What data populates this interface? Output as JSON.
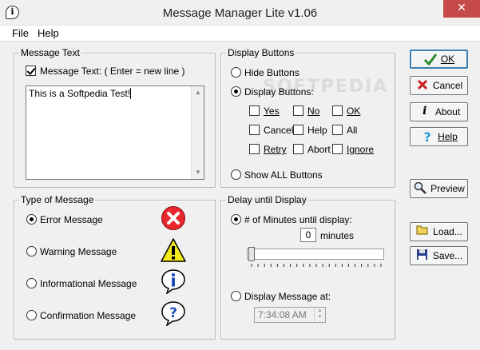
{
  "window": {
    "title": "Message Manager Lite v1.06",
    "close": "✕"
  },
  "menu": {
    "file": "File",
    "help": "Help"
  },
  "watermark": "SOFTPEDIA",
  "message_text": {
    "legend": "Message Text",
    "checkbox_label": "Message Text: ( Enter = new line )",
    "checkbox_checked": true,
    "value": "This is a Softpedia Test!"
  },
  "display_buttons": {
    "legend": "Display Buttons",
    "hide": "Hide Buttons",
    "display": "Display Buttons:",
    "selected": "display",
    "options": {
      "yes": "Yes",
      "no": "No",
      "ok": "OK",
      "cancel": "Cancel",
      "help": "Help",
      "all": "All",
      "retry": "Retry",
      "abort": "Abort",
      "ignore": "Ignore"
    },
    "show_all": "Show ALL Buttons"
  },
  "type_of_message": {
    "legend": "Type of Message",
    "error": "Error Message",
    "warning": "Warning Message",
    "info": "Informational Message",
    "confirm": "Confirmation Message",
    "selected": "error"
  },
  "delay": {
    "legend": "Delay until Display",
    "minutes_label": "# of Minutes until display:",
    "minutes_value": "0",
    "minutes_unit": "minutes",
    "display_at_label": "Display Message at:",
    "time_value": "7:34:08 AM",
    "selected": "minutes",
    "slider_level": 0
  },
  "buttons": {
    "ok": "OK",
    "cancel": "Cancel",
    "about": "About",
    "help": "Help",
    "preview": "Preview",
    "load": "Load...",
    "save": "Save..."
  },
  "colors": {
    "error": "#e8262c",
    "warning": "#f3ea1a",
    "info": "#1f4fbf",
    "ok_check": "#2a8a2a",
    "cancel_x": "#c81e1e"
  }
}
